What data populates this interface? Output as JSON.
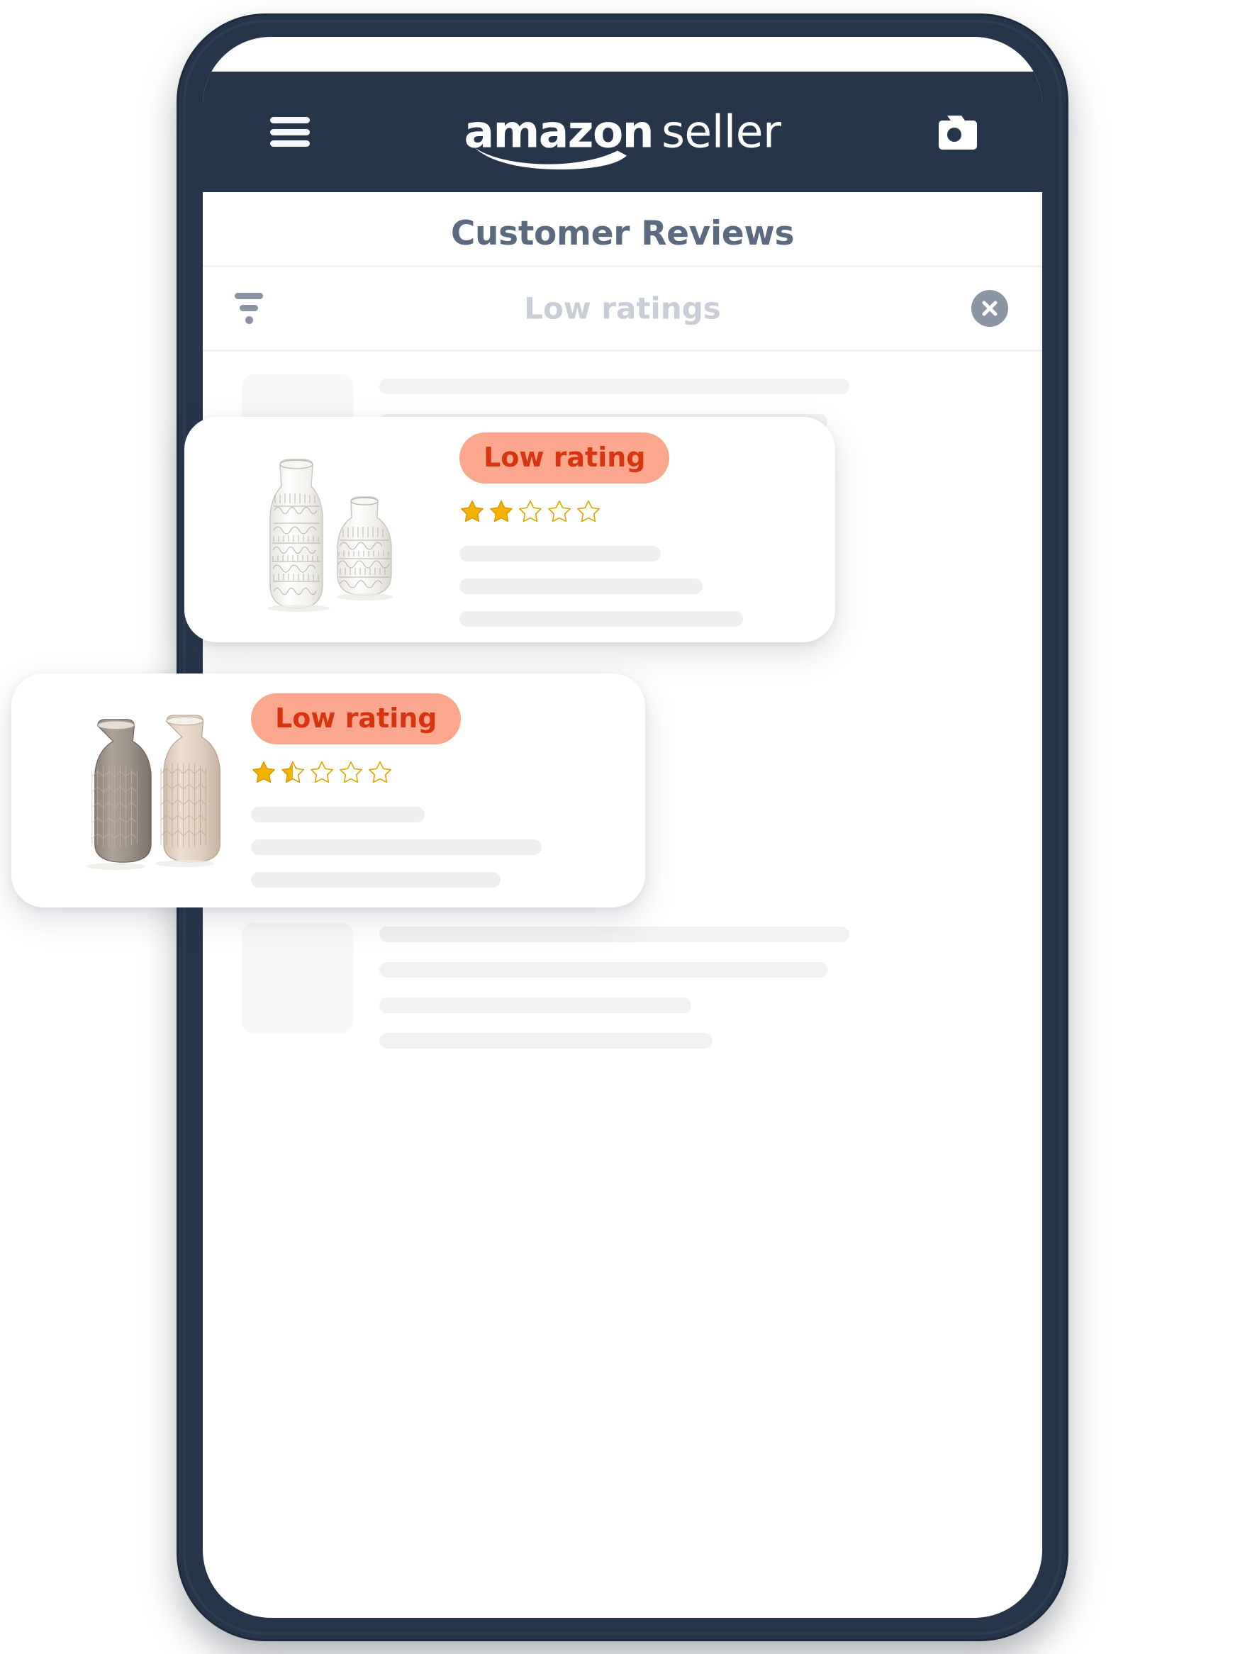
{
  "app": {
    "brand_primary": "amazon",
    "brand_secondary": "seller",
    "header_bg": "#27354a",
    "menu_icon": "hamburger-icon",
    "camera_icon": "camera-icon"
  },
  "page": {
    "title": "Customer Reviews"
  },
  "filter": {
    "icon": "filter-funnel-icon",
    "label": "Low ratings",
    "clear_icon": "close-circle-icon"
  },
  "skeletons": [
    {
      "lines": 4
    },
    {
      "lines": 4
    }
  ],
  "reviews": [
    {
      "badge": "Low rating",
      "badge_bg": "#fba78d",
      "badge_color": "#d6350f",
      "rating": 2,
      "rating_max": 5,
      "star_color": "#f5b300",
      "product": "white-patterned-vases",
      "lines": 3
    },
    {
      "badge": "Low rating",
      "badge_bg": "#fba78d",
      "badge_color": "#d6350f",
      "rating": 1.5,
      "rating_max": 5,
      "star_color": "#f5b300",
      "product": "tan-herringbone-vases",
      "lines": 3
    }
  ]
}
